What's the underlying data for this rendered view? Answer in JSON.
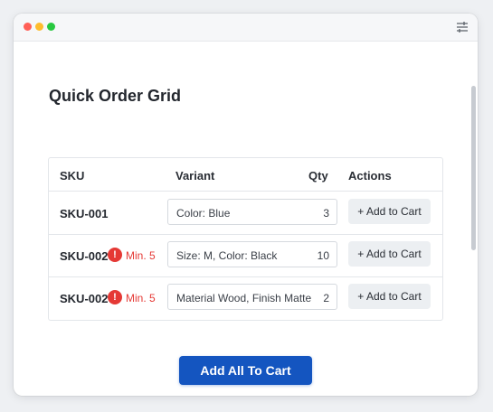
{
  "page": {
    "title": "Quick Order Grid"
  },
  "window": {
    "menu_icon": "sliders-icon"
  },
  "grid": {
    "headers": {
      "sku": "SKU",
      "variant": "Variant",
      "qty": "Qty",
      "actions": "Actions"
    },
    "rows": [
      {
        "sku": "SKU-001",
        "warning": "",
        "variant": "Color: Blue",
        "qty": "3",
        "action": "+ Add to Cart"
      },
      {
        "sku": "SKU-002",
        "warning": "Min. 5",
        "variant": "Size: M, Color: Black",
        "qty": "10",
        "action": "+ Add to Cart"
      },
      {
        "sku": "SKU-002",
        "warning": "Min. 5",
        "variant": "Material Wood, Finish Matte",
        "qty": "2",
        "action": "+ Add to Cart"
      }
    ]
  },
  "footer": {
    "add_all_label": "Add All To Cart"
  },
  "colors": {
    "primary": "#1455c0",
    "warning": "#e53935"
  }
}
